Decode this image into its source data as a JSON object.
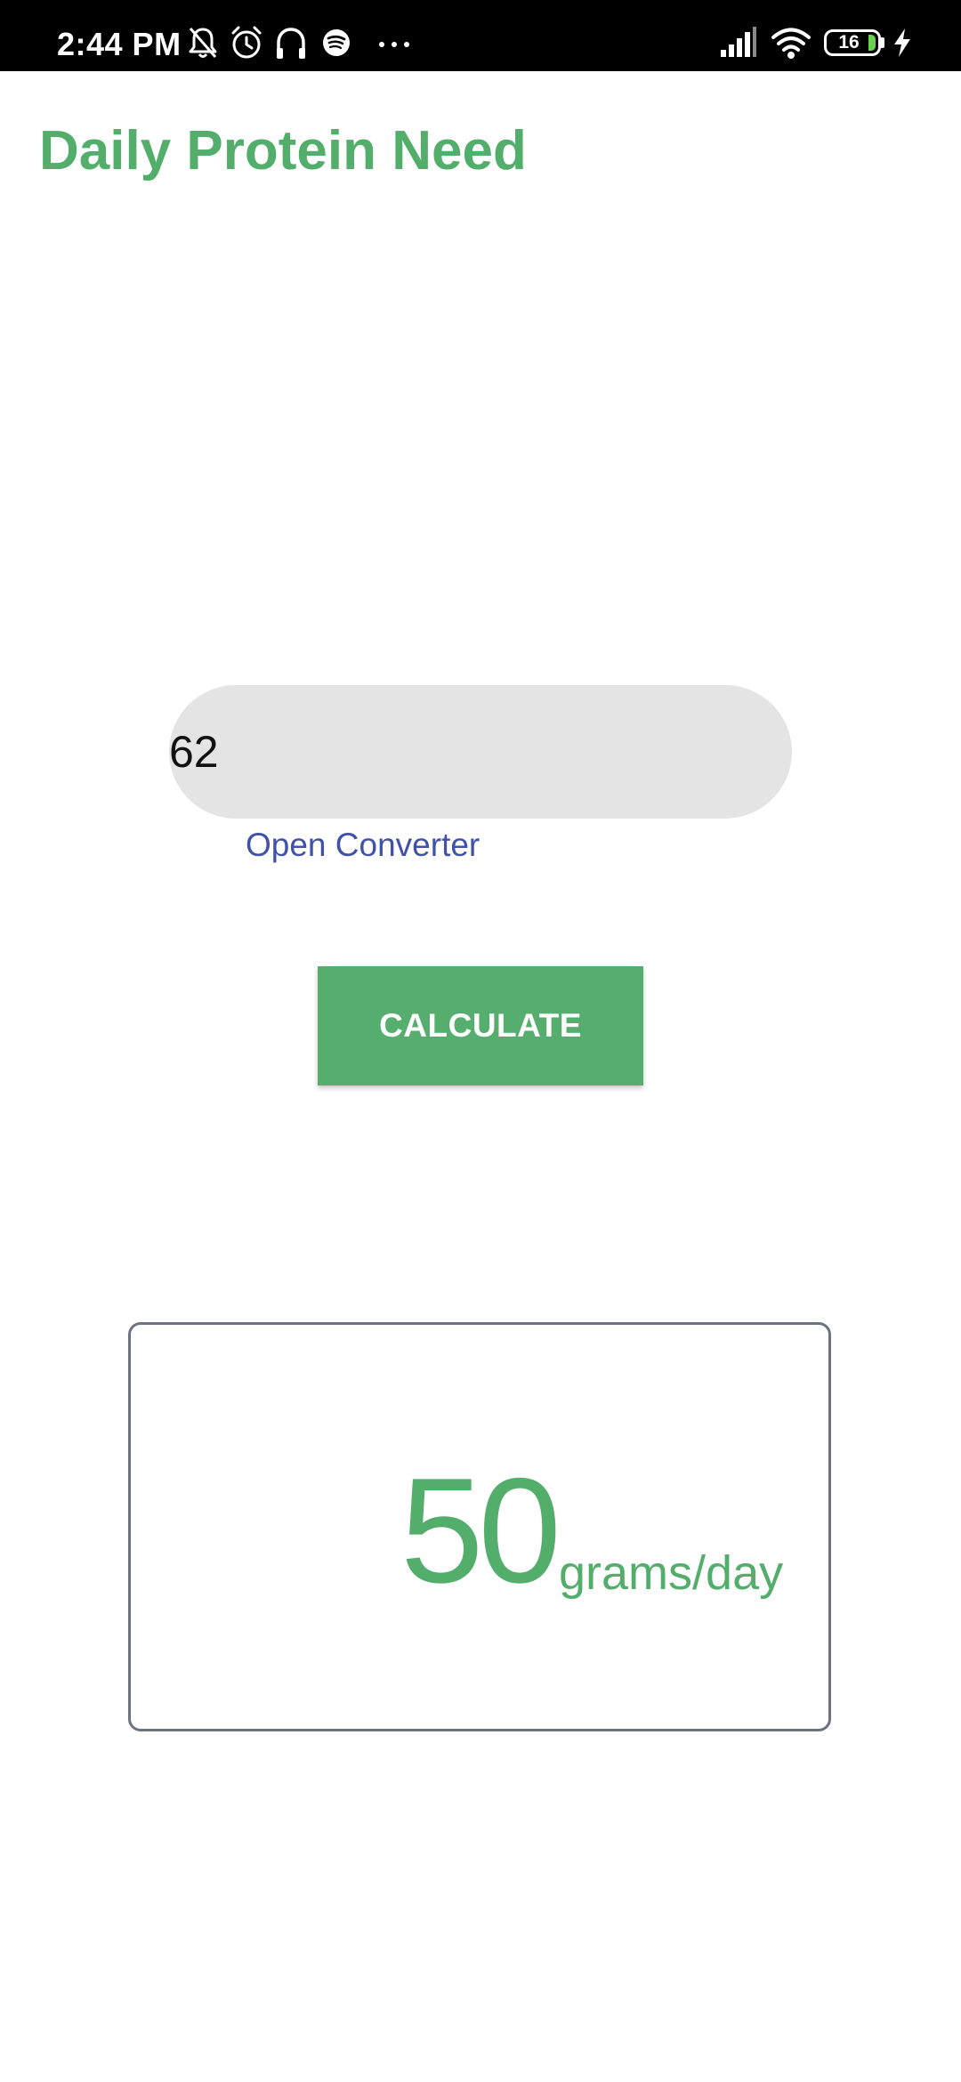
{
  "status_bar": {
    "time": "2:44 PM",
    "left_icons": [
      "bell-off-icon",
      "alarm-clock-icon",
      "headphones-icon",
      "spotify-icon",
      "more-dots-icon"
    ],
    "right_icons": [
      "signal-icon",
      "wifi-icon",
      "battery-icon",
      "charging-bolt-icon"
    ],
    "battery_level": "16",
    "battery_color": "#6ad04e"
  },
  "header": {
    "title": "Daily Protein Need"
  },
  "form": {
    "weight_value": "62",
    "converter_link": "Open Converter",
    "calculate_label": "CALCULATE"
  },
  "result": {
    "value": "50",
    "unit": "grams/day"
  },
  "colors": {
    "accent_green": "#53ad6b",
    "link_blue": "#3f51a8",
    "input_bg": "#e4e4e4",
    "card_border": "#6c7380"
  }
}
